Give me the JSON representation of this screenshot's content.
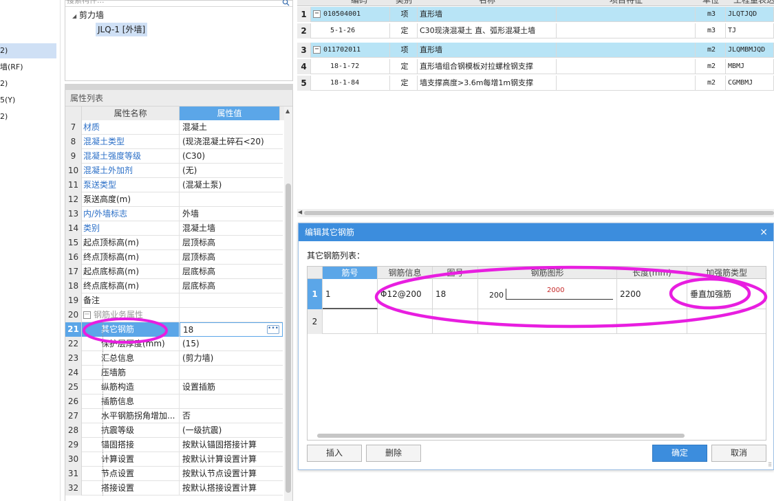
{
  "left_nav": {
    "items": [
      {
        "label": "2)",
        "selected": true
      },
      {
        "label": "墙(RF)",
        "selected": false
      },
      {
        "label": "2)",
        "selected": false
      },
      {
        "label": "5(Y)",
        "selected": false
      },
      {
        "label": "2)",
        "selected": false
      }
    ]
  },
  "component_tree": {
    "search_placeholder": "搜索构件...",
    "root": "剪力墙",
    "child": "JLQ-1 [外墙]"
  },
  "properties": {
    "title": "属性列表",
    "col_name": "属性名称",
    "col_value": "属性值",
    "rows": [
      {
        "num": "7",
        "name": "材质",
        "value": "混凝土",
        "style": "blue"
      },
      {
        "num": "8",
        "name": "混凝土类型",
        "value": "(现浇混凝土碎石<20)",
        "style": "blue"
      },
      {
        "num": "9",
        "name": "混凝土强度等级",
        "value": "(C30)",
        "style": "blue"
      },
      {
        "num": "10",
        "name": "混凝土外加剂",
        "value": "(无)",
        "style": "blue"
      },
      {
        "num": "11",
        "name": "泵送类型",
        "value": "(混凝土泵)",
        "style": "blue"
      },
      {
        "num": "12",
        "name": "泵送高度(m)",
        "value": "",
        "style": "plain"
      },
      {
        "num": "13",
        "name": "内/外墙标志",
        "value": "外墙",
        "style": "blue"
      },
      {
        "num": "14",
        "name": "类别",
        "value": "混凝土墙",
        "style": "blue"
      },
      {
        "num": "15",
        "name": "起点顶标高(m)",
        "value": "层顶标高",
        "style": "plain"
      },
      {
        "num": "16",
        "name": "终点顶标高(m)",
        "value": "层顶标高",
        "style": "plain"
      },
      {
        "num": "17",
        "name": "起点底标高(m)",
        "value": "层底标高",
        "style": "plain"
      },
      {
        "num": "18",
        "name": "终点底标高(m)",
        "value": "层底标高",
        "style": "plain"
      },
      {
        "num": "19",
        "name": "备注",
        "value": "",
        "style": "plain"
      },
      {
        "num": "20",
        "name": "钢筋业务属性",
        "value": "",
        "style": "group"
      },
      {
        "num": "21",
        "name": "其它钢筋",
        "value": "18",
        "style": "active"
      },
      {
        "num": "22",
        "name": "保护层厚度(mm)",
        "value": "(15)",
        "style": "child"
      },
      {
        "num": "23",
        "name": "汇总信息",
        "value": "(剪力墙)",
        "style": "child"
      },
      {
        "num": "24",
        "name": "压墙筋",
        "value": "",
        "style": "child"
      },
      {
        "num": "25",
        "name": "纵筋构造",
        "value": "设置插筋",
        "style": "child"
      },
      {
        "num": "26",
        "name": "插筋信息",
        "value": "",
        "style": "child"
      },
      {
        "num": "27",
        "name": "水平钢筋拐角增加...",
        "value": "否",
        "style": "child"
      },
      {
        "num": "28",
        "name": "抗震等级",
        "value": "(一级抗震)",
        "style": "child"
      },
      {
        "num": "29",
        "name": "锚固搭接",
        "value": "按默认锚固搭接计算",
        "style": "child"
      },
      {
        "num": "30",
        "name": "计算设置",
        "value": "按默认计算设置计算",
        "style": "child"
      },
      {
        "num": "31",
        "name": "节点设置",
        "value": "按默认节点设置计算",
        "style": "child"
      },
      {
        "num": "32",
        "name": "搭接设置",
        "value": "按默认搭接设置计算",
        "style": "child"
      }
    ]
  },
  "quota": {
    "headers": {
      "code": "编码",
      "type": "类别",
      "name": "名称",
      "feature": "项目特征",
      "unit": "单位",
      "expr": "工程量表达"
    },
    "rows": [
      {
        "num": "1",
        "code": "010504001",
        "type": "项",
        "name": "直形墙",
        "feature": "",
        "unit": "m3",
        "expr": "JLQTJQD",
        "hl": true,
        "expander": true
      },
      {
        "num": "2",
        "code": "5-1-26",
        "type": "定",
        "name": "C30现浇混凝土 直、弧形混凝土墙",
        "feature": "",
        "unit": "m3",
        "expr": "TJ",
        "hl": false,
        "expander": false
      },
      {
        "num": "3",
        "code": "011702011",
        "type": "项",
        "name": "直形墙",
        "feature": "",
        "unit": "m2",
        "expr": "JLQMBMJQD",
        "hl": true,
        "expander": true
      },
      {
        "num": "4",
        "code": "18-1-72",
        "type": "定",
        "name": "直形墙组合钢模板对拉螺栓钢支撑",
        "feature": "",
        "unit": "m2",
        "expr": "MBMJ",
        "hl": false,
        "expander": false
      },
      {
        "num": "5",
        "code": "18-1-84",
        "type": "定",
        "name": "墙支撑高度>3.6m每增1m钢支撑",
        "feature": "",
        "unit": "m2",
        "expr": "CGMBMJ",
        "hl": false,
        "expander": false
      }
    ]
  },
  "dialog": {
    "title": "编辑其它钢筋",
    "close": "×",
    "list_label": "其它钢筋列表：",
    "columns": {
      "bar_no": "筋号",
      "bar_info": "钢筋信息",
      "figure_no": "图号",
      "shape": "钢筋图形",
      "length": "长度(mm)",
      "type": "加强筋类型"
    },
    "rows": [
      {
        "num": "1",
        "bar_no": "1",
        "bar_info": "Φ12@200",
        "figure_no": "18",
        "shape_left": "200",
        "shape_top": "2000",
        "length": "2200",
        "type": "垂直加强筋"
      },
      {
        "num": "2",
        "bar_no": "",
        "bar_info": "",
        "figure_no": "",
        "shape_left": "",
        "shape_top": "",
        "length": "",
        "type": ""
      }
    ],
    "buttons": {
      "insert": "插入",
      "delete": "删除",
      "ok": "确定",
      "cancel": "取消"
    }
  },
  "colors": {
    "accent": "#3c8ddd",
    "highlight": "#b8e4f6",
    "annotation": "#e81ee0"
  }
}
